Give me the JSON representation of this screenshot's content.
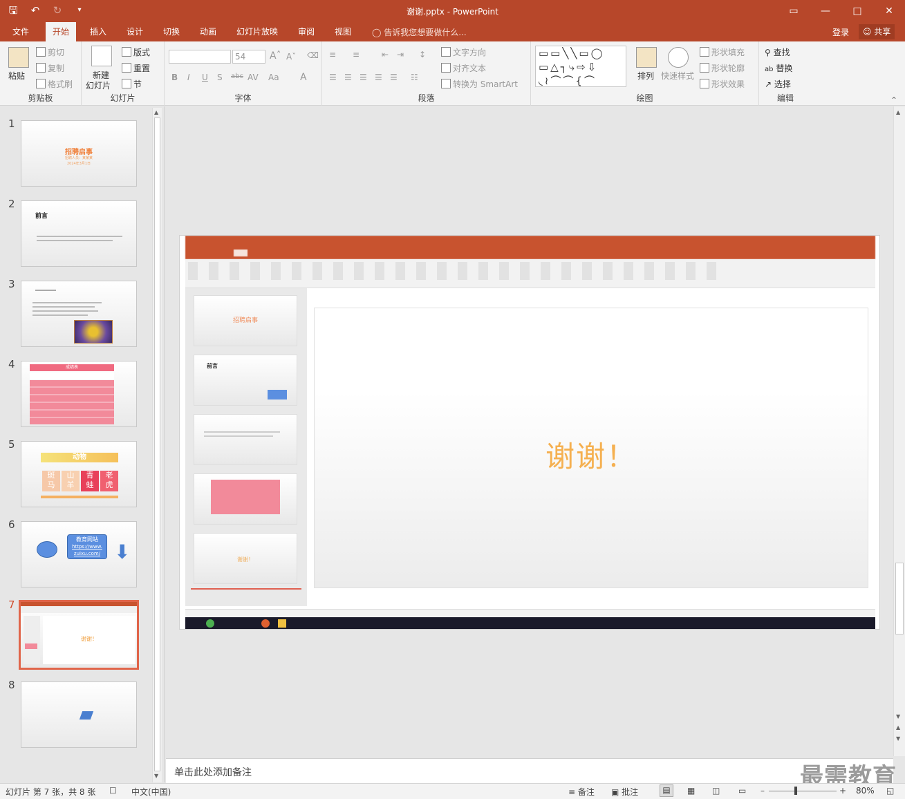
{
  "window": {
    "title": "谢谢.pptx - PowerPoint",
    "controls": [
      "▭",
      "—",
      "□",
      "✕"
    ]
  },
  "tabs": {
    "items": [
      "文件",
      "开始",
      "插入",
      "设计",
      "切换",
      "动画",
      "幻灯片放映",
      "审阅",
      "视图"
    ],
    "active": "开始",
    "tellme": "告诉我您想要做什么...",
    "login": "登录",
    "share": "共享"
  },
  "ribbon": {
    "clipboard": {
      "label": "剪贴板",
      "paste": "粘贴",
      "cut": "剪切",
      "copy": "复制",
      "format_painter": "格式刷"
    },
    "slides": {
      "label": "幻灯片",
      "new_slide_1": "新建",
      "new_slide_2": "幻灯片",
      "layout": "版式",
      "reset": "重置",
      "section": "节"
    },
    "font": {
      "label": "字体",
      "font_name": "",
      "font_size": "54"
    },
    "paragraph": {
      "label": "段落",
      "text_direction": "文字方向",
      "align_text": "对齐文本",
      "convert_smartart": "转换为 SmartArt"
    },
    "drawing": {
      "label": "绘图",
      "arrange": "排列",
      "quick_styles": "快速样式",
      "shape_fill": "形状填充",
      "shape_outline": "形状轮廓",
      "shape_effects": "形状效果"
    },
    "editing": {
      "label": "编辑",
      "find": "查找",
      "replace": "替换",
      "select": "选择"
    }
  },
  "thumbnails": [
    {
      "num": "1",
      "title": "招聘启事",
      "line1": "招聘人员：某某某",
      "line2": "2024年3月1日"
    },
    {
      "num": "2",
      "title": "前言"
    },
    {
      "num": "3"
    },
    {
      "num": "4",
      "header": "成绩表"
    },
    {
      "num": "5",
      "title": "动物",
      "chars": [
        "斑",
        "山",
        "青",
        "老",
        "马",
        "羊",
        "蛙",
        "虎"
      ]
    },
    {
      "num": "6",
      "badge": "教育网站",
      "link1": "https://www.",
      "link2": "zuixu.com/"
    },
    {
      "num": "7",
      "text": "谢谢！"
    },
    {
      "num": "8"
    }
  ],
  "slide": {
    "main_text": "谢谢！",
    "inner_thumb_1_title": "招聘启事",
    "inner_thumb_2_title": "前言",
    "inner_thumb_5_text": "谢谢！"
  },
  "notes": {
    "placeholder": "单击此处添加备注"
  },
  "status": {
    "slide_info": "幻灯片 第 7 张，共 8 张",
    "language": "中文(中国)",
    "notes": "备注",
    "comments": "批注",
    "zoom": "80%"
  },
  "watermark": "最需教育",
  "colors": {
    "accent": "#b7472a",
    "selected_thumb": "#e0654a",
    "title_orange": "#f0a040"
  }
}
